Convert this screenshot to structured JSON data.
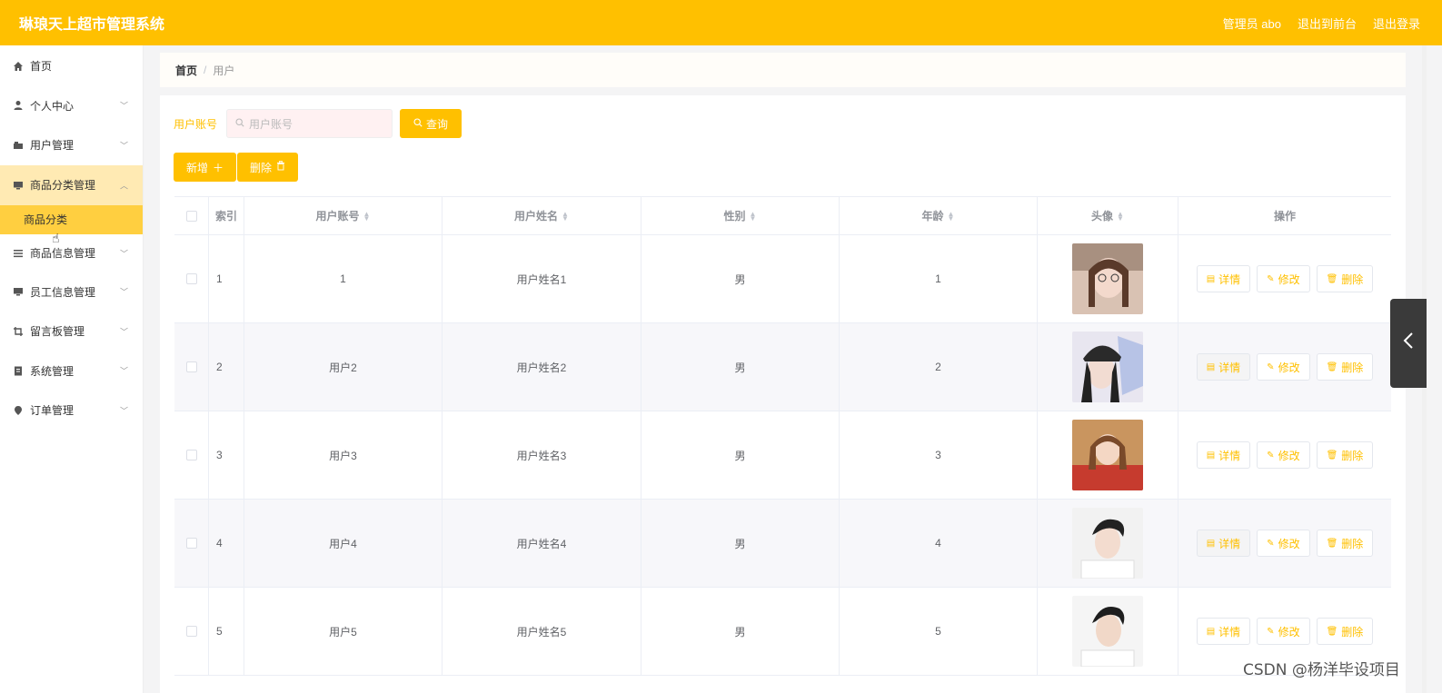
{
  "app": {
    "title": "琳琅天上超市管理系统",
    "user_label": "管理员 abo",
    "to_front": "退出到前台",
    "logout": "退出登录"
  },
  "sidebar": {
    "items": [
      {
        "label": "首页",
        "icon": "home-icon"
      },
      {
        "label": "个人中心",
        "icon": "person-icon"
      },
      {
        "label": "用户管理",
        "icon": "users-icon"
      },
      {
        "label": "商品分类管理",
        "icon": "monitor-icon"
      },
      {
        "label": "商品信息管理",
        "icon": "list-icon"
      },
      {
        "label": "员工信息管理",
        "icon": "monitor-icon"
      },
      {
        "label": "留言板管理",
        "icon": "crop-icon"
      },
      {
        "label": "系统管理",
        "icon": "clipboard-icon"
      },
      {
        "label": "订单管理",
        "icon": "pin-icon"
      }
    ],
    "sub_item": "商品分类"
  },
  "breadcrumb": {
    "home": "首页",
    "sep": "/",
    "current": "用户"
  },
  "search": {
    "label": "用户账号",
    "placeholder": "用户账号",
    "button": "查询"
  },
  "actions": {
    "add": "新增",
    "delete": "删除"
  },
  "table": {
    "columns": [
      "索引",
      "用户账号",
      "用户姓名",
      "性别",
      "年龄",
      "头像",
      "操作"
    ],
    "rows": [
      {
        "index": "1",
        "account": "1",
        "name": "用户姓名1",
        "gender": "男",
        "age": "1"
      },
      {
        "index": "2",
        "account": "用户2",
        "name": "用户姓名2",
        "gender": "男",
        "age": "2"
      },
      {
        "index": "3",
        "account": "用户3",
        "name": "用户姓名3",
        "gender": "男",
        "age": "3"
      },
      {
        "index": "4",
        "account": "用户4",
        "name": "用户姓名4",
        "gender": "男",
        "age": "4"
      },
      {
        "index": "5",
        "account": "用户5",
        "name": "用户姓名5",
        "gender": "男",
        "age": "5"
      }
    ],
    "ops": {
      "detail": "详情",
      "edit": "修改",
      "delete": "删除"
    }
  },
  "watermark": "CSDN @杨洋毕设项目",
  "colors": {
    "accent": "#ffc000",
    "submenu_active": "#ffcf40",
    "menu_open": "#ffeab3"
  }
}
